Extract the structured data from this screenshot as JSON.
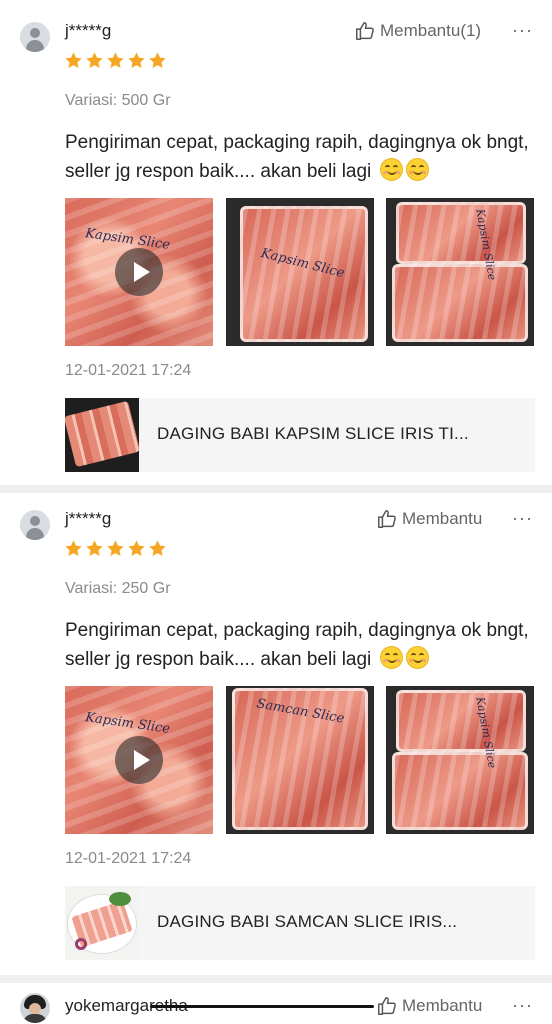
{
  "reviews": [
    {
      "username": "j*****g",
      "helpful_label": "Membantu(1)",
      "more_label": "···",
      "rating": 5,
      "variant": "Variasi: 500 Gr",
      "comment": "Pengiriman cepat, packaging rapih, dagingnya ok bngt, seller jg respon baik.... akan beli lagi",
      "media": [
        {
          "type": "video",
          "note": "Kapsim Slice"
        },
        {
          "type": "image",
          "note": "Kapsim Slice"
        },
        {
          "type": "image",
          "note": "Kapsim Slice"
        }
      ],
      "date": "12-01-2021 17:24",
      "product_name": "DAGING BABI KAPSIM SLICE IRIS TI..."
    },
    {
      "username": "j*****g",
      "helpful_label": "Membantu",
      "more_label": "···",
      "rating": 5,
      "variant": "Variasi: 250 Gr",
      "comment": "Pengiriman cepat, packaging rapih, dagingnya ok bngt, seller jg respon baik.... akan beli lagi",
      "media": [
        {
          "type": "video",
          "note": "Kapsim Slice"
        },
        {
          "type": "image",
          "note": "Samcan Slice"
        },
        {
          "type": "image",
          "note": "Kapsim Slice"
        }
      ],
      "date": "12-01-2021 17:24",
      "product_name": "DAGING BABI SAMCAN SLICE IRIS..."
    },
    {
      "username": "yokemargaretha",
      "helpful_label": "Membantu",
      "more_label": "···"
    }
  ],
  "colors": {
    "star": "#f5a623",
    "muted_text": "#8a8a8a",
    "divider": "#f0f0f0",
    "product_bg": "#f5f5f5"
  },
  "icons": {
    "avatar": "user-silhouette-icon",
    "helpful": "thumbs-up-icon",
    "more": "more-dots-icon",
    "star": "star-icon",
    "play": "play-icon"
  }
}
